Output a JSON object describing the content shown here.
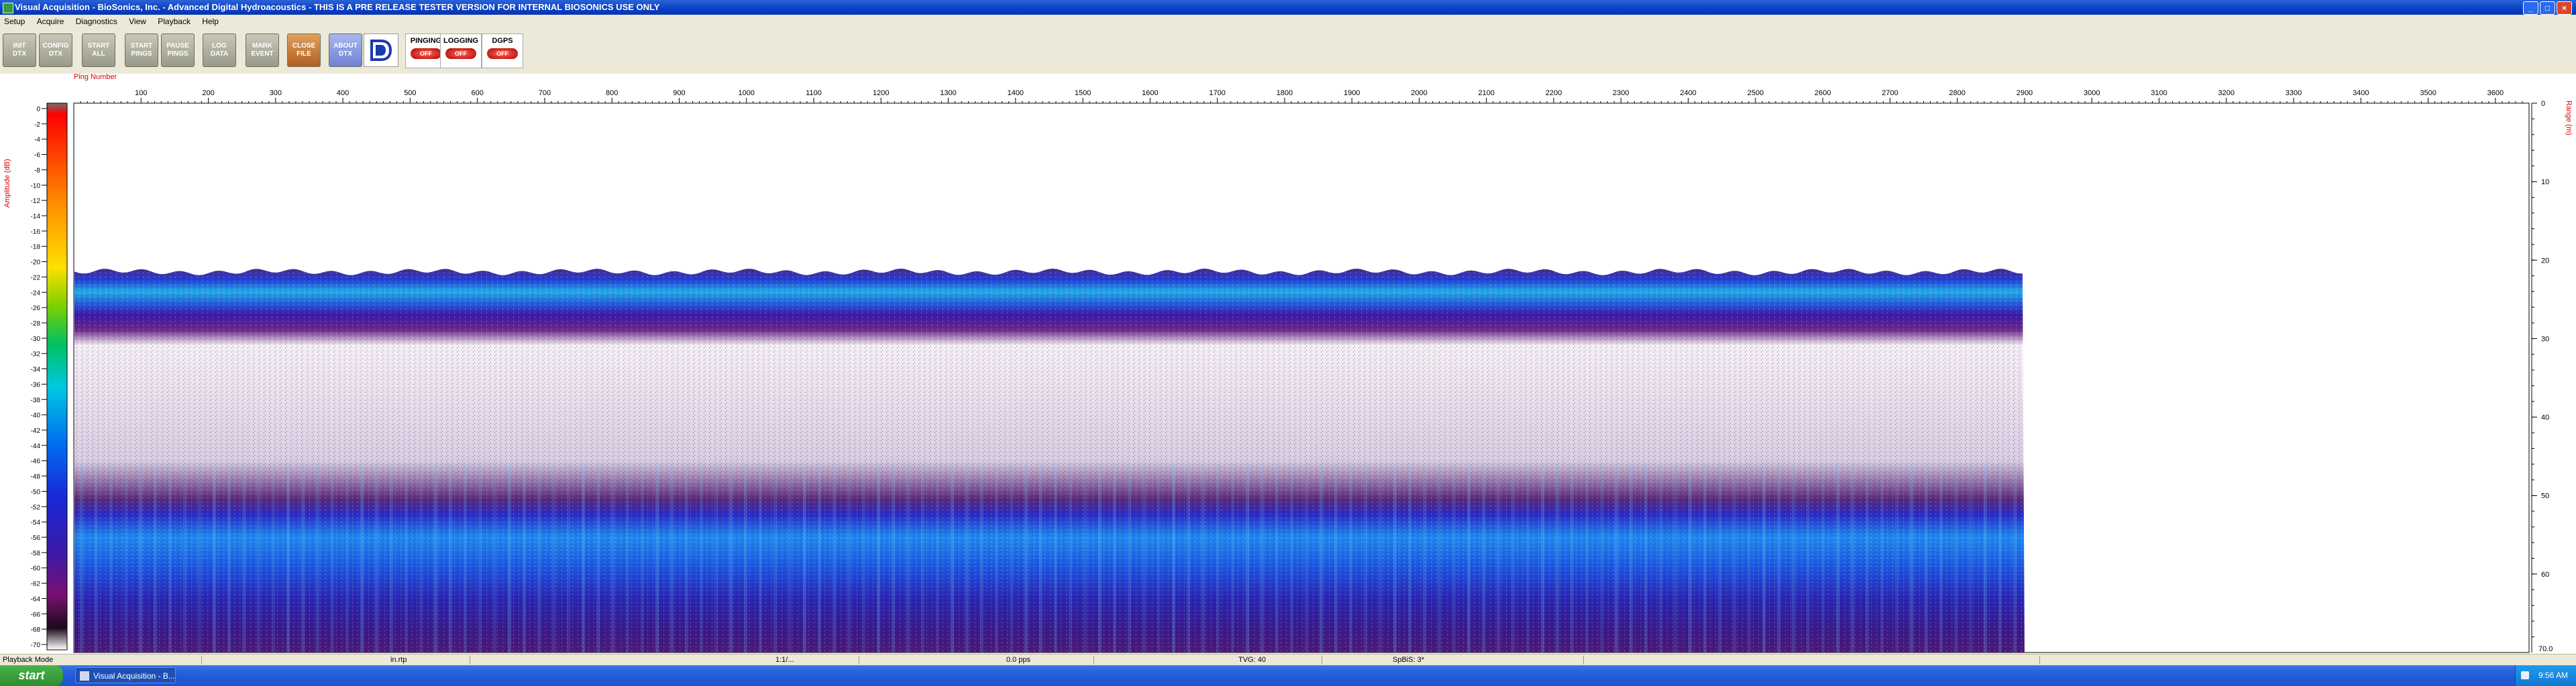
{
  "window": {
    "title": "Visual Acquisition  -  BioSonics, Inc.  -  Advanced Digital Hydroacoustics  -  THIS IS A PRE RELEASE TESTER VERSION FOR INTERNAL BIOSONICS USE ONLY",
    "minimize": "_",
    "maximize": "□",
    "close": "×"
  },
  "menu": [
    "Setup",
    "Acquire",
    "Diagnostics",
    "View",
    "Playback",
    "Help"
  ],
  "toolbar": {
    "buttons": [
      {
        "label": "INIT\nDTX",
        "style": "gray"
      },
      {
        "label": "CONFIG\nDTX",
        "style": "gray"
      },
      {
        "label": "START\nALL",
        "style": "gray"
      },
      {
        "label": "START\nPINGS",
        "style": "gray"
      },
      {
        "label": "PAUSE\nPINGS",
        "style": "gray"
      },
      {
        "label": "LOG\nDATA",
        "style": "gray"
      },
      {
        "label": "MARK\nEVENT",
        "style": "gray"
      },
      {
        "label": "CLOSE\nFILE",
        "style": "orange"
      },
      {
        "label": "ABOUT\nDTX",
        "style": "blue"
      }
    ],
    "indicators": [
      {
        "label": "PINGING",
        "state": "OFF"
      },
      {
        "label": "LOGGING",
        "state": "OFF"
      },
      {
        "label": "DGPS",
        "state": "OFF"
      }
    ]
  },
  "echogram": {
    "x_axis_title": "Ping Number",
    "x_ticks": [
      100,
      200,
      300,
      400,
      500,
      600,
      700,
      800,
      900,
      1000,
      1100,
      1200,
      1300,
      1400,
      1500,
      1600,
      1700,
      1800,
      1900,
      2000,
      2100,
      2200,
      2300,
      2400,
      2500,
      2600,
      2700,
      2800,
      2900,
      3000,
      3100,
      3200,
      3300,
      3400,
      3500,
      3600
    ],
    "x_range": [
      0,
      3650
    ],
    "data_extent_pings": 2900,
    "left_axis_title": "Amplitude (dB)",
    "left_ticks": [
      0,
      -2,
      -4,
      -6,
      -8,
      -10,
      -12,
      -14,
      -16,
      -18,
      -20,
      -22,
      -24,
      -26,
      -28,
      -30,
      -32,
      -34,
      -36,
      -38,
      -40,
      -42,
      -44,
      -46,
      -48,
      -50,
      -52,
      -54,
      -56,
      -58,
      -60,
      -62,
      -64,
      -66,
      -68,
      -70
    ],
    "right_axis_title": "Range (m)",
    "right_ticks": [
      0,
      10,
      20,
      30,
      40,
      50,
      60
    ],
    "right_max_label": "70.0",
    "range_max": 70,
    "colors": {
      "axis_label": "#e00000",
      "grid_text": "#000000"
    }
  },
  "status_bar": {
    "mode": "Playback Mode",
    "units": "in.rtp",
    "file": "1:1/...",
    "rate": "0.0 pps",
    "tvg": "TVG: 40",
    "spb": "SpBiS: 3*"
  },
  "taskbar": {
    "start": "start",
    "task": "Visual Acquisition - B...",
    "clock": "9:56 AM"
  }
}
